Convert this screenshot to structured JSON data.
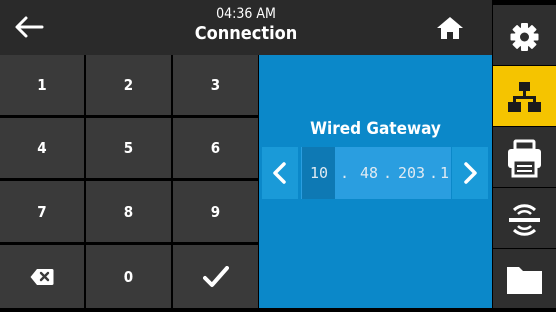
{
  "header": {
    "time": "04:36 AM",
    "title": "Connection"
  },
  "keypad": {
    "keys": [
      "1",
      "2",
      "3",
      "4",
      "5",
      "6",
      "7",
      "8",
      "9",
      "0"
    ]
  },
  "field": {
    "label": "Wired Gateway",
    "ip_segments": [
      "10",
      "48",
      "203",
      "1"
    ],
    "separators": [
      ".",
      ".",
      "."
    ],
    "selected_segment": 0
  },
  "sidebar": {
    "items": [
      "gear-icon",
      "network-icon",
      "printer-icon",
      "sensor-icon",
      "folder-icon"
    ],
    "active_item": "network-icon"
  },
  "colors": {
    "header_bg": "#2a2a2a",
    "key_bg": "#3a3a3a",
    "panel_bg": "#0b88c9",
    "active_accent": "#f5c400"
  }
}
